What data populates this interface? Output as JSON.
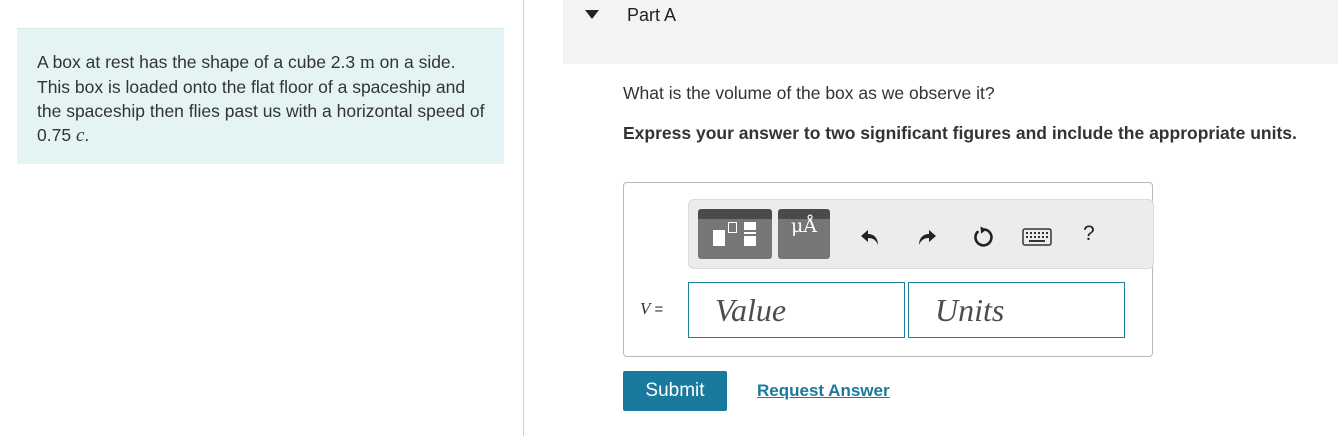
{
  "problem": {
    "text_before_m": "A box at rest has the shape of a cube 2.3 ",
    "unit_m": "m",
    "text_after_m": " on a side. This box is loaded onto the flat floor of a spaceship and the spaceship then flies past us with a horizontal speed of 0.75 ",
    "c_symbol": "c",
    "period": "."
  },
  "part": {
    "title": "Part A"
  },
  "question": "What is the volume of the box as we observe it?",
  "instructions": "Express your answer to two significant figures and include the appropriate units.",
  "toolbar": {
    "units_glyph": "μÅ",
    "help_label": "?",
    "icons": [
      "templates-icon",
      "units-icon",
      "undo-icon",
      "redo-icon",
      "reset-icon",
      "keyboard-icon",
      "help-icon"
    ]
  },
  "answer": {
    "variable": "V",
    "equals": " =",
    "value_placeholder": "Value",
    "units_placeholder": "Units"
  },
  "actions": {
    "submit_label": "Submit",
    "request_label": "Request Answer"
  },
  "colors": {
    "accent": "#1a7a9d",
    "panel": "#e4f4f4",
    "input_border": "#1c8194"
  }
}
